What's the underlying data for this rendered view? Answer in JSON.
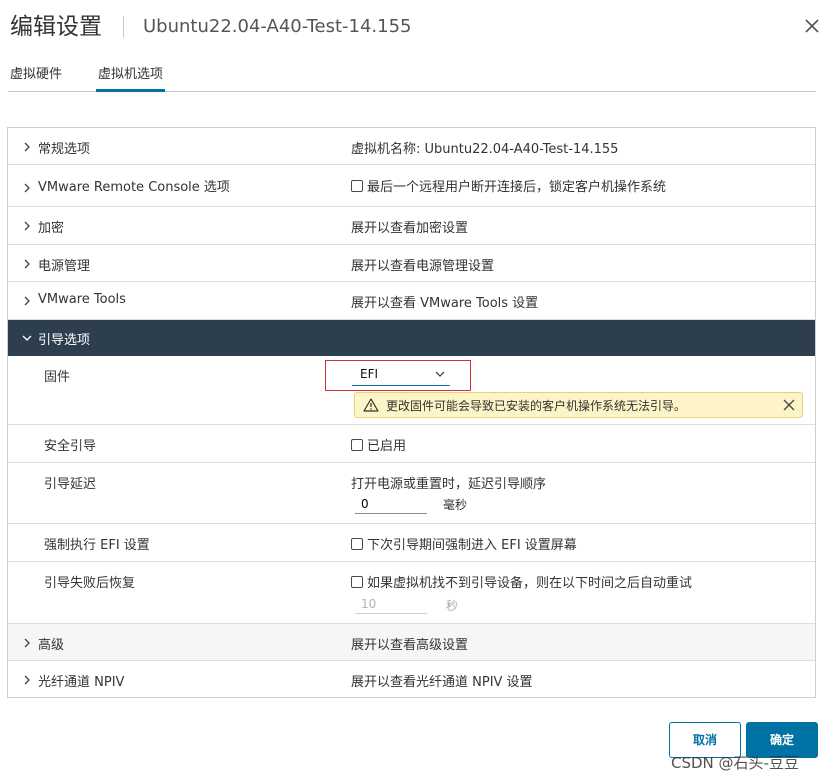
{
  "dialog": {
    "title": "编辑设置",
    "vm_name": "Ubuntu22.04-A40-Test-14.155"
  },
  "tabs": [
    {
      "label": "虚拟硬件",
      "active": false
    },
    {
      "label": "虚拟机选项",
      "active": true
    }
  ],
  "sections": {
    "general": {
      "label": "常规选项",
      "value": "虚拟机名称: Ubuntu22.04-A40-Test-14.155"
    },
    "vmrc": {
      "label": "VMware Remote Console 选项",
      "value": "最后一个远程用户断开连接后，锁定客户机操作系统",
      "checked": false
    },
    "encryption": {
      "label": "加密",
      "value": "展开以查看加密设置"
    },
    "power": {
      "label": "电源管理",
      "value": "展开以查看电源管理设置"
    },
    "tools": {
      "label": "VMware Tools",
      "value": "展开以查看 VMware Tools 设置"
    },
    "boot": {
      "label": "引导选项",
      "firmware": {
        "label": "固件",
        "value": "EFI"
      },
      "warning": "更改固件可能会导致已安装的客户机操作系统无法引导。",
      "secure_boot": {
        "label": "安全引导",
        "value": "已启用",
        "checked": false
      },
      "boot_delay": {
        "label": "引导延迟",
        "desc": "打开电源或重置时，延迟引导顺序",
        "value": "0",
        "unit": "毫秒"
      },
      "force_efi": {
        "label": "强制执行 EFI 设置",
        "value": "下次引导期间强制进入 EFI 设置屏幕",
        "checked": false
      },
      "failed_boot": {
        "label": "引导失败后恢复",
        "value": "如果虚拟机找不到引导设备，则在以下时间之后自动重试",
        "checked": false,
        "retry_value": "10",
        "unit": "秒"
      }
    },
    "advanced": {
      "label": "高级",
      "value": "展开以查看高级设置"
    },
    "npiv": {
      "label": "光纤通道 NPIV",
      "value": "展开以查看光纤通道 NPIV 设置"
    }
  },
  "buttons": {
    "cancel": "取消",
    "ok": "确定"
  },
  "watermark": "CSDN @石头-豆豆",
  "colors": {
    "accent": "#0072a3",
    "section_header": "#2d3e4e",
    "highlight_border": "#d4303a",
    "warning_bg": "#fdf4c7"
  }
}
